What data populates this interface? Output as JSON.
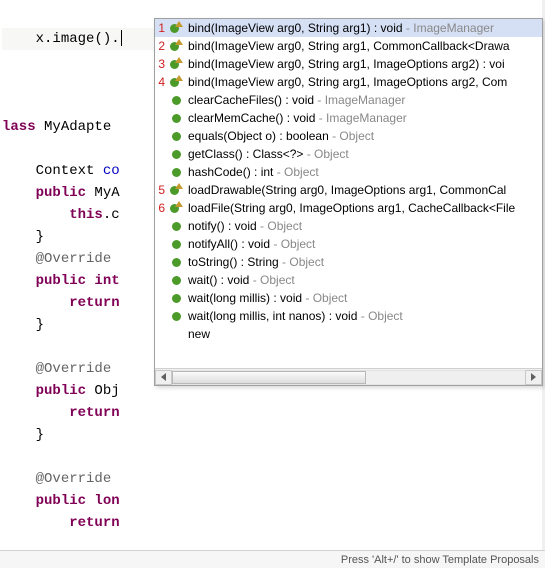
{
  "editor": {
    "line1_prefix": "    x.",
    "line1_call": "image",
    "line1_suffix": "().",
    "class_kw": "lass ",
    "class_name": "MyAdapte",
    "ctx_line": "    Context ",
    "ctx_field": "co",
    "pub_kw": "public",
    "myA": " MyA",
    "this_kw": "this",
    "dot_c": ".c",
    "brace_close": "    }",
    "override": "@Override",
    "int_kw": " int",
    "return_kw": "return",
    "obj_decl": " Obj",
    "lon_decl": " lon",
    "four_sp": "    ",
    "eight_sp": "        ",
    "twelve_sp": "            "
  },
  "popup": {
    "items": [
      {
        "rank": "1",
        "icon": "sup",
        "label": "bind(ImageView arg0, String arg1) : void",
        "src": "ImageManager",
        "sel": true
      },
      {
        "rank": "2",
        "icon": "sup",
        "label": "bind(ImageView arg0, String arg1, CommonCallback<Drawa",
        "src": "",
        "sel": false
      },
      {
        "rank": "3",
        "icon": "sup",
        "label": "bind(ImageView arg0, String arg1, ImageOptions arg2) : voi",
        "src": "",
        "sel": false
      },
      {
        "rank": "4",
        "icon": "sup",
        "label": "bind(ImageView arg0, String arg1, ImageOptions arg2, Com",
        "src": "",
        "sel": false
      },
      {
        "rank": "",
        "icon": "pub",
        "label": "clearCacheFiles() : void",
        "src": "ImageManager",
        "sel": false
      },
      {
        "rank": "",
        "icon": "pub",
        "label": "clearMemCache() : void",
        "src": "ImageManager",
        "sel": false
      },
      {
        "rank": "",
        "icon": "pub",
        "label": "equals(Object o) : boolean",
        "src": "Object",
        "sel": false
      },
      {
        "rank": "",
        "icon": "pub",
        "label": "getClass() : Class<?>",
        "src": "Object",
        "sel": false
      },
      {
        "rank": "",
        "icon": "pub",
        "label": "hashCode() : int",
        "src": "Object",
        "sel": false
      },
      {
        "rank": "5",
        "icon": "sup",
        "label": "loadDrawable(String arg0, ImageOptions arg1, CommonCal",
        "src": "",
        "sel": false
      },
      {
        "rank": "6",
        "icon": "sup",
        "label": "loadFile(String arg0, ImageOptions arg1, CacheCallback<File",
        "src": "",
        "sel": false
      },
      {
        "rank": "",
        "icon": "pub",
        "label": "notify() : void",
        "src": "Object",
        "sel": false
      },
      {
        "rank": "",
        "icon": "pub",
        "label": "notifyAll() : void",
        "src": "Object",
        "sel": false
      },
      {
        "rank": "",
        "icon": "pub",
        "label": "toString() : String",
        "src": "Object",
        "sel": false
      },
      {
        "rank": "",
        "icon": "pub",
        "label": "wait() : void",
        "src": "Object",
        "sel": false
      },
      {
        "rank": "",
        "icon": "pub",
        "label": "wait(long millis) : void",
        "src": "Object",
        "sel": false
      },
      {
        "rank": "",
        "icon": "pub",
        "label": "wait(long millis, int nanos) : void",
        "src": "Object",
        "sel": false
      },
      {
        "rank": "",
        "icon": "none",
        "label": "new",
        "src": "",
        "sel": false
      }
    ]
  },
  "statusbar": {
    "hint": "Press 'Alt+/' to show Template Proposals"
  }
}
